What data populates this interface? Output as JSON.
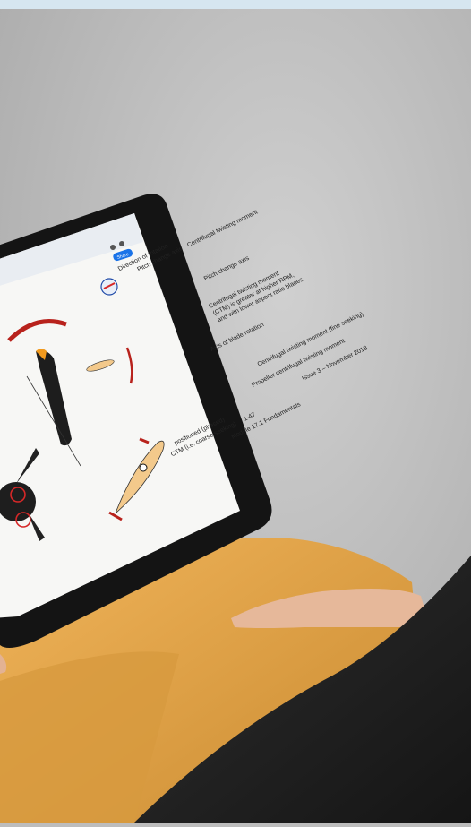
{
  "document": {
    "share_button": "Share",
    "diagram_labels": {
      "direction_of_rotation": "Direction of rotation",
      "pitch_change_axis": "Pitch change axis",
      "centrifugal_twisting_moment_top": "Centrifugal twisting moment",
      "pitch_change_axis_small": "Pitch change axis",
      "ctm_note_1": "Centrifugal twisting moment",
      "ctm_note_2": "(CTM) is greater at higher RPM,",
      "ctm_note_3": "and with lower aspect ratio blades",
      "axis_of_blade_rotation": "Axis of blade rotation",
      "centrifugal_twisting_moment_bottom": "Centrifugal twisting moment (fine seeking)",
      "caption": "Propeller centrifugal twisting moment",
      "left_caption_1": "positioned (phased)",
      "left_caption_2": "CTM (i.e. coarse seeking)"
    },
    "footer": {
      "page_number": "1-47",
      "module": "Module 17.1 Fundamentals",
      "issue": "Issue 3 – November 2018"
    }
  },
  "colors": {
    "carpet": "#c4c4c4",
    "tablet_bezel": "#161616",
    "trousers": "#e8a94a",
    "jacket": "#232323",
    "blade_tan": "#f3c98b",
    "arrow_red": "#c0241e"
  }
}
